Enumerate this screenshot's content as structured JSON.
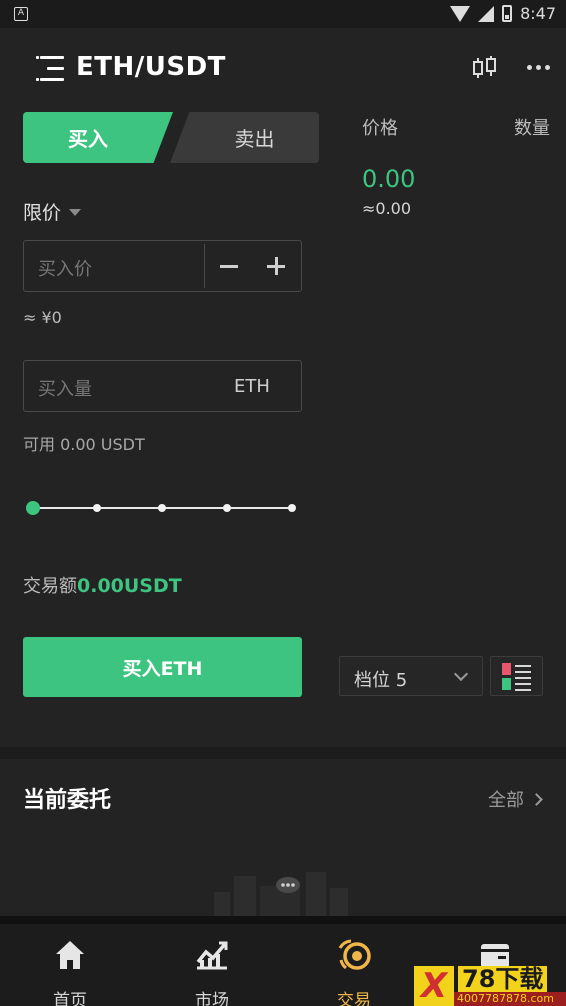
{
  "status_bar": {
    "time": "8:47",
    "notification_icon": "a-icon"
  },
  "header": {
    "title": "ETH/USDT",
    "menu_icon": "menu-icon",
    "compare_icon": "kline-compare-icon",
    "more_icon": "more-icon"
  },
  "trade": {
    "buy_tab": "买入",
    "sell_tab": "卖出",
    "order_type": "限价",
    "price_placeholder": "买入价",
    "approx_value": "≈ ¥0",
    "amount_placeholder": "买入量",
    "amount_unit": "ETH",
    "available": "可用 0.00 USDT",
    "slider_percent": 0,
    "volume_label": "交易额",
    "volume_value": "0.00USDT",
    "buy_button": "买入ETH"
  },
  "orderbook": {
    "price_header": "价格",
    "quantity_header": "数量",
    "last_price": "0.00",
    "last_price_cny": "≈0.00",
    "depth_label": "档位 5"
  },
  "orders": {
    "title": "当前委托",
    "all_link": "全部"
  },
  "bottom_nav": [
    {
      "label": "首页",
      "icon": "home-icon",
      "active": false
    },
    {
      "label": "市场",
      "icon": "market-chart-icon",
      "active": false
    },
    {
      "label": "交易",
      "icon": "trade-icon",
      "active": true
    },
    {
      "label": "",
      "icon": "wallet-icon",
      "active": false
    }
  ],
  "watermark": {
    "brand": "78下载",
    "site": "4007787878.com",
    "logo_letter": "X"
  },
  "colors": {
    "accent_green": "#3ec481",
    "accent_red": "#e8566d",
    "nav_active": "#f0b64a",
    "background": "#232323"
  }
}
